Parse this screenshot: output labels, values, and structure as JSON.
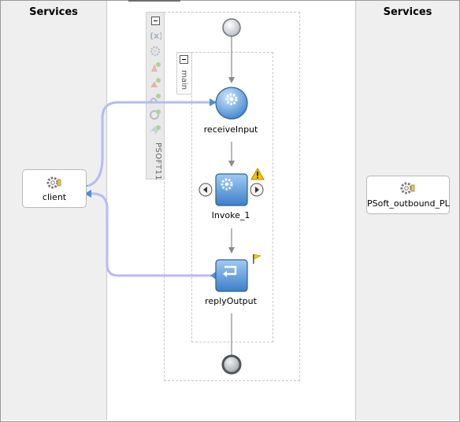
{
  "lanes": {
    "left_title": "Services",
    "right_title": "Services"
  },
  "toolbar": {
    "scope_label": "PSOFT11"
  },
  "scope": {
    "main_label": "main"
  },
  "services": {
    "left": {
      "label": "client"
    },
    "right": {
      "label": "PSoft_outbound_PL"
    }
  },
  "activities": {
    "receive": {
      "label": "receiveInput"
    },
    "invoke": {
      "label": "Invoke_1"
    },
    "reply": {
      "label": "replyOutput"
    }
  },
  "colors": {
    "wire": "#b7baf7",
    "node_blue": "#4d8fd6",
    "warning": "#f5c400",
    "flag": "#e8d000"
  }
}
